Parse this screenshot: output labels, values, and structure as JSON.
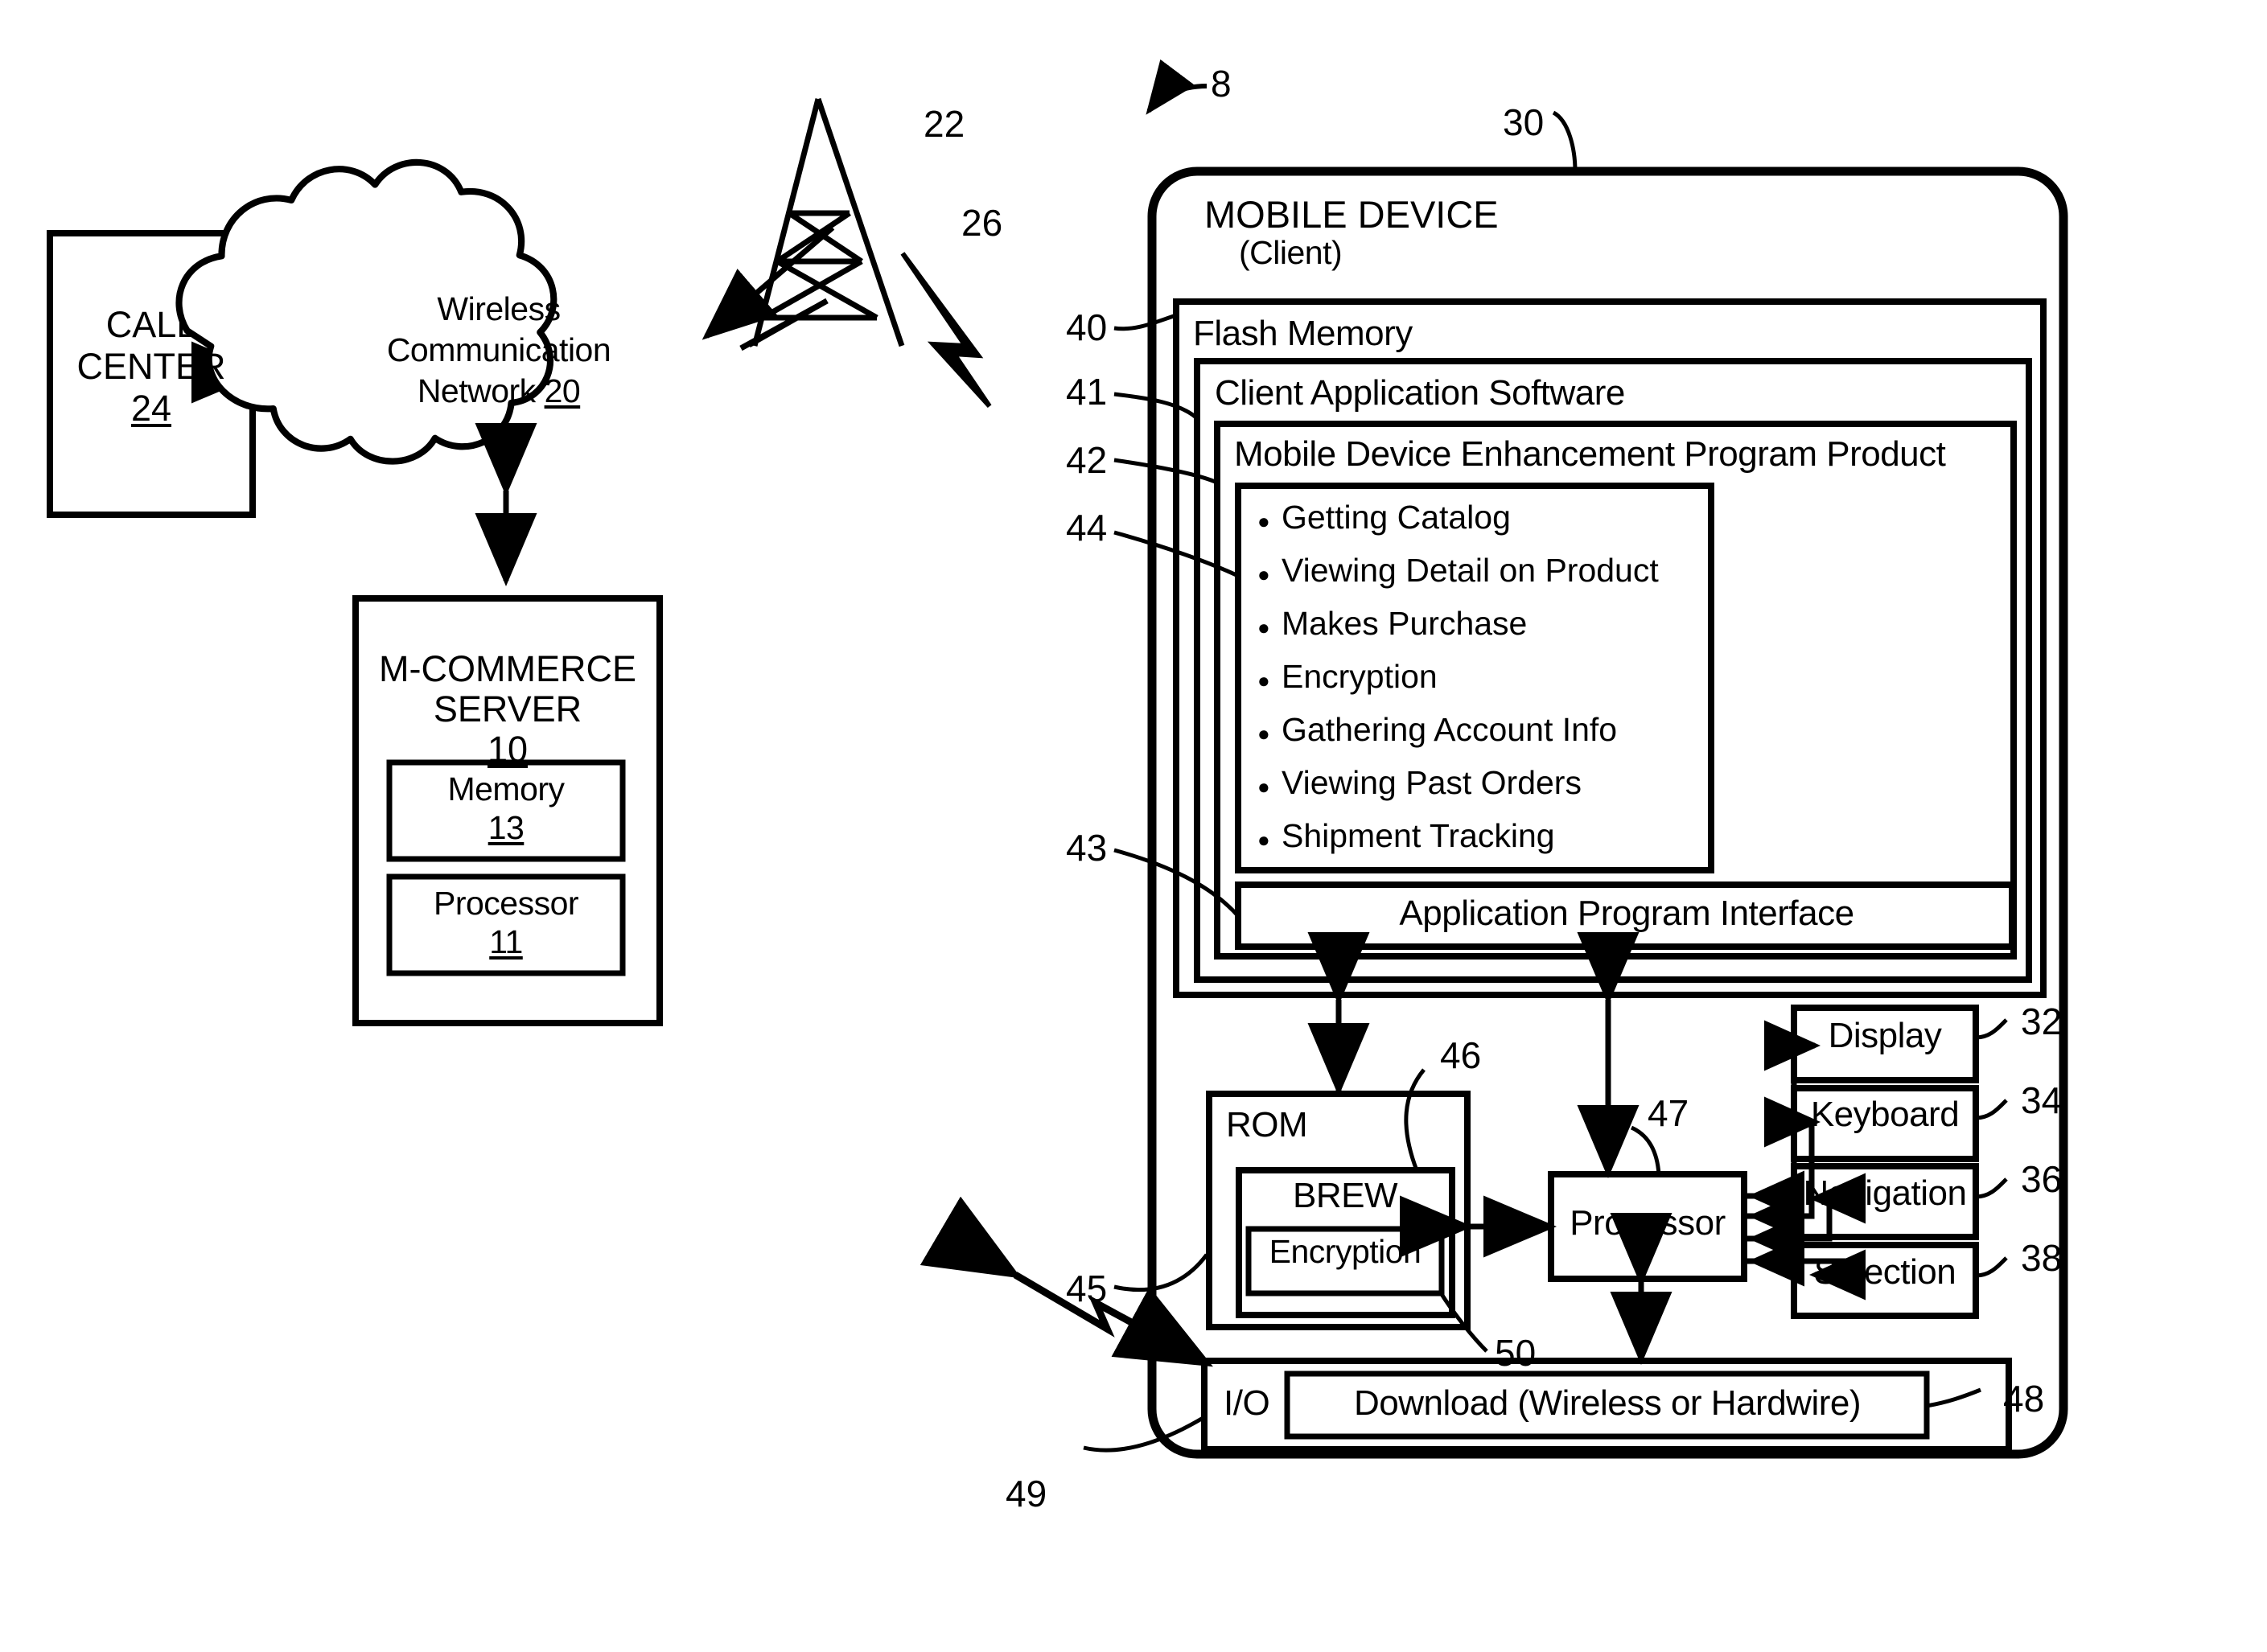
{
  "figure": {
    "system_ref": "8",
    "device_ref": "30"
  },
  "left_side": {
    "call_center": {
      "line1": "CALL",
      "line2": "CENTER",
      "ref": "24"
    },
    "cloud": {
      "line1": "Wireless",
      "line2": "Communication",
      "line3_text": "Network ",
      "line3_ref": "20"
    },
    "tower": {
      "ref": "22"
    },
    "signal": {
      "ref": "26"
    },
    "server": {
      "line1": "M-COMMERCE",
      "line2": "SERVER",
      "ref": "10",
      "memory": {
        "label": "Memory",
        "ref": "13"
      },
      "processor": {
        "label": "Processor",
        "ref": "11"
      }
    }
  },
  "mobile_device": {
    "title_line1": "MOBILE DEVICE",
    "title_line2": "(Client)",
    "ref": "30",
    "flash_memory": {
      "label": "Flash Memory",
      "ref": "40"
    },
    "client_app_software": {
      "label": "Client Application Software",
      "ref": "41"
    },
    "enhancement_program": {
      "label": "Mobile Device Enhancement Program Product",
      "ref": "42"
    },
    "feature_list": {
      "ref": "44",
      "items": [
        "Getting Catalog",
        "Viewing Detail on Product",
        "Makes Purchase",
        "Encryption",
        "Gathering Account Info",
        "Viewing Past Orders",
        "Shipment Tracking"
      ]
    },
    "api": {
      "label": "Application Program Interface",
      "ref": "43"
    },
    "rom": {
      "label": "ROM",
      "ref": "45",
      "brew": {
        "label": "BREW",
        "ref": "46"
      },
      "encryption": {
        "label": "Encryption",
        "ref": "50"
      }
    },
    "processor": {
      "label": "Processor",
      "ref": "47"
    },
    "peripherals": [
      {
        "label": "Display",
        "ref": "32"
      },
      {
        "label": "Keyboard",
        "ref": "34"
      },
      {
        "label": "Navigation",
        "ref": "36"
      },
      {
        "label": "Selection",
        "ref": "38"
      }
    ],
    "io": {
      "label": "I/O",
      "ref": "49"
    },
    "download": {
      "label": "Download (Wireless or Hardwire)",
      "ref": "48"
    }
  },
  "colors": {
    "ink": "#000000",
    "paper": "#ffffff"
  }
}
